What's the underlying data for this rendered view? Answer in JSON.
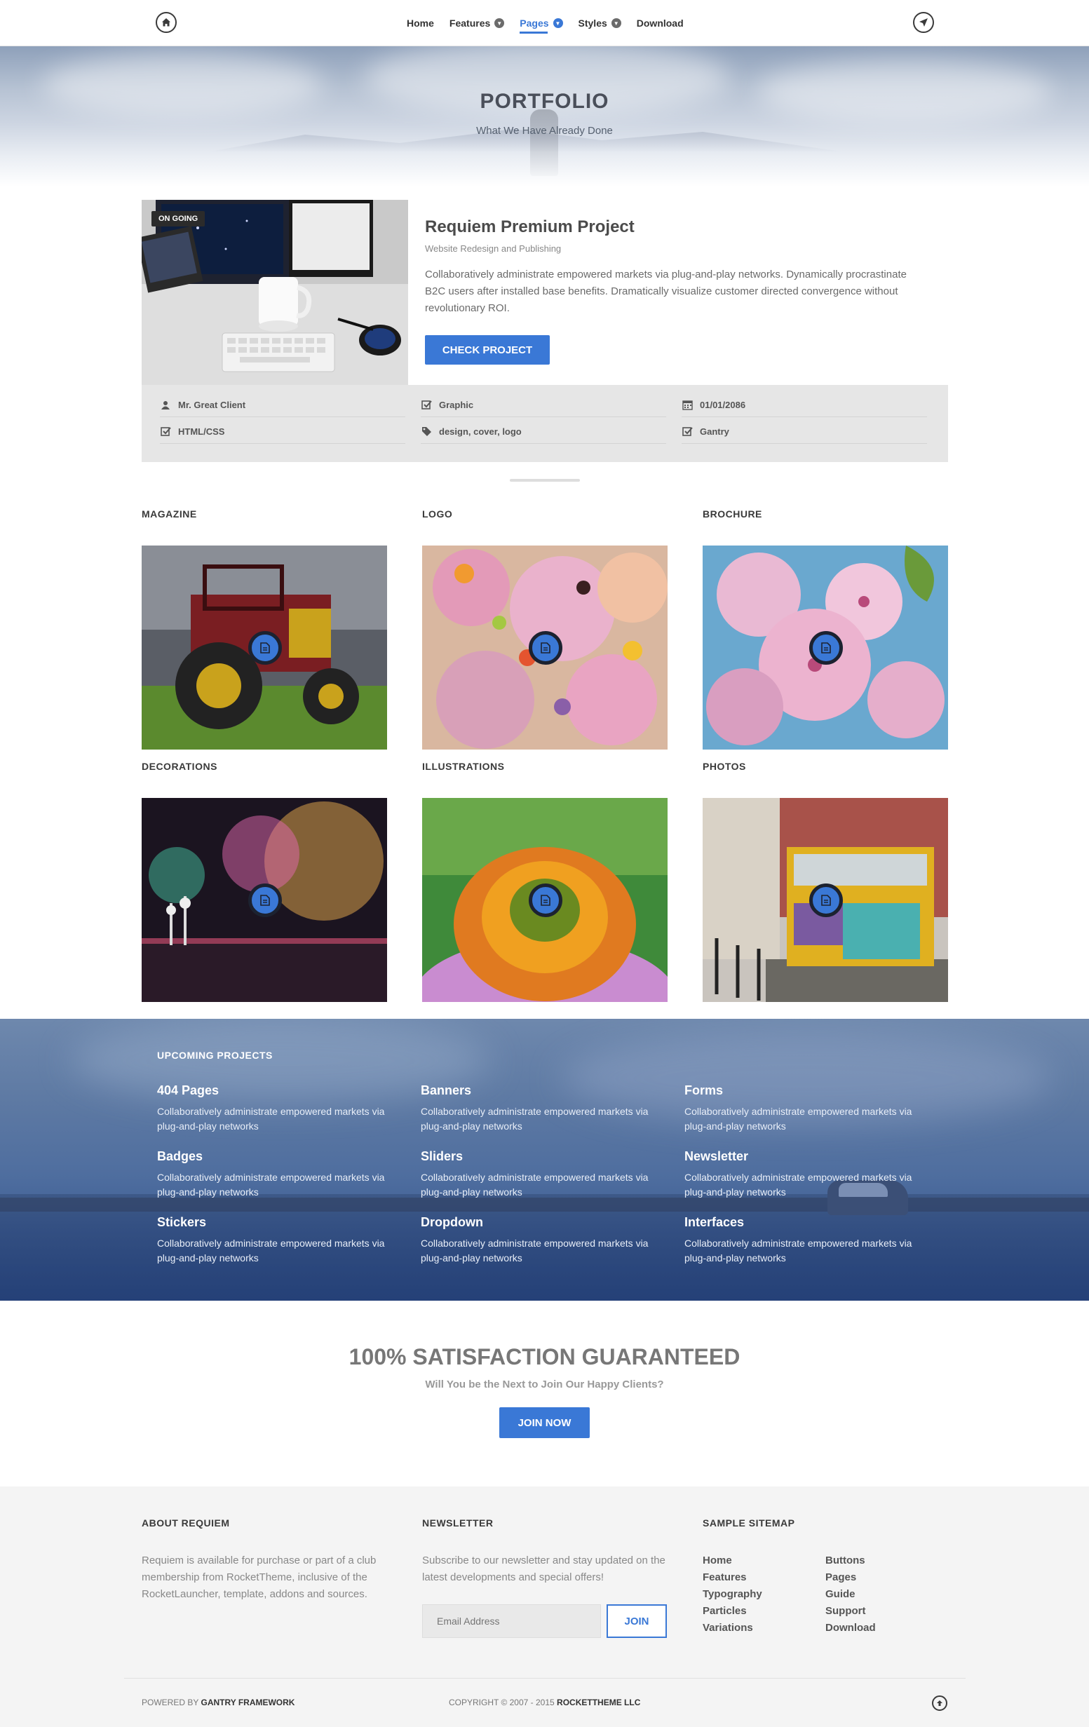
{
  "nav": {
    "items": [
      {
        "label": "Home",
        "dropdown": false,
        "active": false
      },
      {
        "label": "Features",
        "dropdown": true,
        "active": false
      },
      {
        "label": "Pages",
        "dropdown": true,
        "active": true
      },
      {
        "label": "Styles",
        "dropdown": true,
        "active": false
      },
      {
        "label": "Download",
        "dropdown": false,
        "active": false
      }
    ],
    "home_icon": "home-icon",
    "rocket_icon": "rocket-icon"
  },
  "hero": {
    "title": "PORTFOLIO",
    "subtitle": "What We Have Already Done"
  },
  "project": {
    "badge": "ON GOING",
    "title": "Requiem Premium Project",
    "subtitle": "Website Redesign and Publishing",
    "description": "Collaboratively administrate empowered markets via plug-and-play networks. Dynamically procrastinate B2C users after installed base benefits. Dramatically visualize customer directed convergence without revolutionary ROI.",
    "button": "CHECK PROJECT",
    "meta": [
      {
        "icon": "user-icon",
        "label": "Mr. Great Client"
      },
      {
        "icon": "checkbox-icon",
        "label": "Graphic"
      },
      {
        "icon": "calendar-icon",
        "label": "01/01/2086"
      },
      {
        "icon": "checkbox-icon",
        "label": "HTML/CSS"
      },
      {
        "icon": "tag-icon",
        "label": "design, cover, logo"
      },
      {
        "icon": "checkbox-icon",
        "label": "Gantry"
      }
    ]
  },
  "gallery": [
    {
      "category": "MAGAZINE",
      "image": "tractor"
    },
    {
      "category": "LOGO",
      "image": "candy"
    },
    {
      "category": "BROCHURE",
      "image": "blossom"
    },
    {
      "category": "DECORATIONS",
      "image": "fireworks"
    },
    {
      "category": "ILLUSTRATIONS",
      "image": "flower"
    },
    {
      "category": "PHOTOS",
      "image": "tram"
    }
  ],
  "upcoming": {
    "title": "UPCOMING PROJECTS",
    "items": [
      {
        "title": "404 Pages",
        "desc": "Collaboratively administrate empowered markets via plug-and-play networks"
      },
      {
        "title": "Banners",
        "desc": "Collaboratively administrate empowered markets via plug-and-play networks"
      },
      {
        "title": "Forms",
        "desc": "Collaboratively administrate empowered markets via plug-and-play networks"
      },
      {
        "title": "Badges",
        "desc": "Collaboratively administrate empowered markets via plug-and-play networks"
      },
      {
        "title": "Sliders",
        "desc": "Collaboratively administrate empowered markets via plug-and-play networks"
      },
      {
        "title": "Newsletter",
        "desc": "Collaboratively administrate empowered markets via plug-and-play networks"
      },
      {
        "title": "Stickers",
        "desc": "Collaboratively administrate empowered markets via plug-and-play networks"
      },
      {
        "title": "Dropdown",
        "desc": "Collaboratively administrate empowered markets via plug-and-play networks"
      },
      {
        "title": "Interfaces",
        "desc": "Collaboratively administrate empowered markets via plug-and-play networks"
      }
    ]
  },
  "satisfaction": {
    "title": "100% SATISFACTION GUARANTEED",
    "subtitle": "Will You be the Next to Join Our Happy Clients?",
    "button": "JOIN NOW"
  },
  "footer": {
    "about_title": "ABOUT REQUIEM",
    "about_text": "Requiem is available for purchase or part of a club membership from RocketTheme, inclusive of the RocketLauncher, template, addons and sources.",
    "newsletter_title": "NEWSLETTER",
    "newsletter_text": "Subscribe to our newsletter and stay updated on the latest developments and special offers!",
    "email_placeholder": "Email Address",
    "join_button": "JOIN",
    "sitemap_title": "SAMPLE SITEMAP",
    "sitemap_col1": [
      "Home",
      "Features",
      "Typography",
      "Particles",
      "Variations"
    ],
    "sitemap_col2": [
      "Buttons",
      "Pages",
      "Guide",
      "Support",
      "Download"
    ],
    "powered_prefix": "POWERED BY",
    "powered_name": "GANTRY FRAMEWORK",
    "copyright_prefix": "COPYRIGHT © 2007 - 2015",
    "copyright_name": "ROCKETTHEME LLC",
    "top_icon": "arrow-up-icon"
  },
  "colors": {
    "accent": "#3a78d6",
    "footer_bg": "#f4f4f4",
    "meta_bg": "#e6e6e6"
  }
}
